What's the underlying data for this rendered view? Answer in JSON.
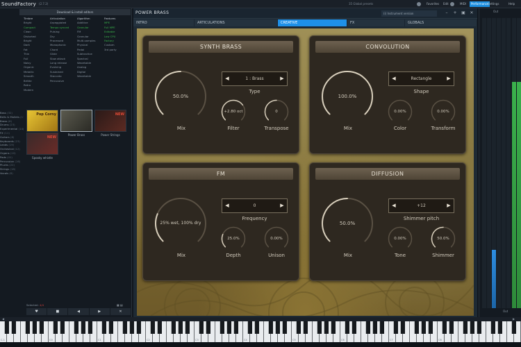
{
  "topbar": {
    "app_title": "SoundFactory",
    "app_version": "(2.7.2)",
    "preset_count": "35 Global presets",
    "items": [
      "Favorites",
      "Edit",
      "MIDI",
      "Performance",
      "Settings",
      "Help"
    ],
    "icons": [
      "star-icon",
      "pencil-icon",
      "gear-icon",
      "question-icon",
      "user-icon"
    ]
  },
  "browser": {
    "download_banner": "Download & install editors",
    "filter_columns": [
      {
        "header": "",
        "items": [
          "",
          "",
          "",
          "",
          "",
          "",
          "",
          "",
          "",
          "",
          "",
          "",
          "",
          "",
          "",
          "",
          "",
          ""
        ]
      },
      {
        "header": "Timbre",
        "items": [
          "Bright",
          "Compact",
          "Clean",
          "Distorted",
          "Bright",
          "Dark",
          "Fat",
          "Thin",
          "Full",
          "Noisy",
          "Organic",
          "Metallic",
          "Smooth",
          "Brittle",
          "Retro",
          "Modern"
        ]
      },
      {
        "header": "Articulation",
        "items": [
          "Arpeggiated",
          "Tempo synced",
          "Pulsing",
          "Dry",
          "Processed",
          "Monophonic",
          "Chord",
          "Glide",
          "Slow attack",
          "Long release",
          "Evolving",
          "Sustained",
          "Staccato",
          "Percussive"
        ]
      },
      {
        "header": "Algorithm",
        "items": [
          "Additive",
          "Granular",
          "FM",
          "Granular",
          "Multi-samples",
          "Physical",
          "Pedal",
          "Subtractive",
          "Spectral",
          "Wavetable",
          "Analog",
          "Digital",
          "Wavetable"
        ]
      },
      {
        "header": "Features",
        "items": [
          "MPE",
          "Full MPE",
          "Editable",
          "Low CPU",
          "Factory",
          "Custom",
          "3rd party"
        ]
      }
    ],
    "categories": [
      {
        "name": "Bass",
        "count": "(32)"
      },
      {
        "name": "Bells & Mallets",
        "count": "(17)"
      },
      {
        "name": "Brass",
        "count": "(6)"
      },
      {
        "name": "Drums",
        "count": "(23)"
      },
      {
        "name": "Experimental",
        "count": "(14)"
      },
      {
        "name": "FX",
        "count": "(11)"
      },
      {
        "name": "Guitars",
        "count": "(8)"
      },
      {
        "name": "Keyboards",
        "count": "(23)"
      },
      {
        "name": "Leads",
        "count": "(19)"
      },
      {
        "name": "Orchestral",
        "count": "(12)"
      },
      {
        "name": "Organs",
        "count": "(10)"
      },
      {
        "name": "Pads",
        "count": "(41)"
      },
      {
        "name": "Percussion",
        "count": "(16)"
      },
      {
        "name": "Plucks",
        "count": "(22)"
      },
      {
        "name": "Strings",
        "count": "(18)"
      },
      {
        "name": "Vocals",
        "count": "(6)"
      }
    ],
    "presets": [
      {
        "name": "Pop Corny",
        "badge": "Pop Corny"
      },
      {
        "name": "Power Brass",
        "badge": ""
      },
      {
        "name": "Power Strings",
        "badge": "NEW"
      },
      {
        "name": "Spooky whistle",
        "badge": "NEW"
      }
    ],
    "selected_count_label": "Selected:",
    "selected_count_value": "4/4",
    "toolbar": [
      "♥",
      "■",
      "◀",
      "▶",
      "✕"
    ]
  },
  "panel": {
    "title": "POWER BRASS",
    "instrument_select": "(i) Instrument version",
    "tabs": [
      "INTRO",
      "ARTICULATIONS",
      "CREATIVE",
      "FX",
      "GLOBALS"
    ],
    "active_tab": "CREATIVE",
    "modules": [
      {
        "title": "SYNTH BRASS",
        "mix_value": "50.0%",
        "mix_label": "Mix",
        "selector_value": "1 : Brass",
        "selector_label": "Type",
        "knob_a_value": "+2.80 oct",
        "knob_a_label": "Filter",
        "knob_b_value": "0",
        "knob_b_label": "Transpose",
        "mix_level": 0.5,
        "a_level": 0.7,
        "b_level": 0.5
      },
      {
        "title": "CONVOLUTION",
        "mix_value": "100.0%",
        "mix_label": "Mix",
        "selector_value": "Rectangle",
        "selector_label": "Shape",
        "knob_a_value": "0.00%",
        "knob_a_label": "Color",
        "knob_b_value": "0.00%",
        "knob_b_label": "Transform",
        "mix_level": 1.0,
        "a_level": 0.0,
        "b_level": 0.0
      },
      {
        "title": "FM",
        "mix_value": "25% wet, 100% dry",
        "mix_label": "Mix",
        "selector_value": "0",
        "selector_label": "Frequency",
        "knob_a_value": "25.0%",
        "knob_a_label": "Depth",
        "knob_b_value": "0.00%",
        "knob_b_label": "Unison",
        "mix_level": 0.25,
        "a_level": 0.25,
        "b_level": 0.0
      },
      {
        "title": "DIFFUSION",
        "mix_value": "50.0%",
        "mix_label": "Mix",
        "selector_value": "+12",
        "selector_label": "Shimmer pitch",
        "knob_a_value": "0.00%",
        "knob_a_label": "Tone",
        "knob_b_value": "50.0%",
        "knob_b_label": "Shimmer",
        "mix_level": 0.5,
        "a_level": 0.0,
        "b_level": 0.5
      }
    ]
  },
  "mixer": {
    "header": "Out",
    "meter_levels": [
      0.0,
      0.0,
      0.2,
      0.0,
      0.0,
      0.0,
      0.78,
      0.78
    ],
    "footer": "Out"
  },
  "keyboard": {
    "octave_labels": [
      "C-1",
      "C0",
      "C1",
      "C2",
      "C3",
      "C4",
      "C5",
      "C6",
      "C7",
      "C8"
    ]
  },
  "colors": {
    "accent": "#1e90e8",
    "green": "#39b54a",
    "knob_arc": "#d8cfbc",
    "knob_track": "#5a5144"
  }
}
